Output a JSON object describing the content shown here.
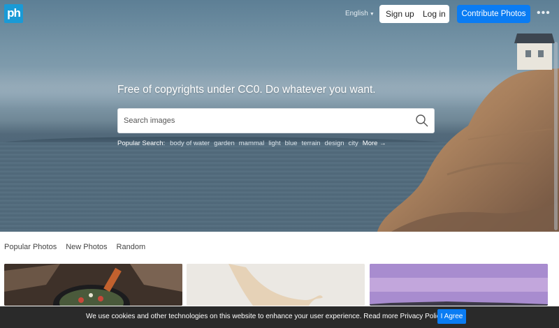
{
  "header": {
    "logo": "ph",
    "language": "English",
    "signup_label": "Sign up",
    "login_label": "Log in",
    "contribute_label": "Contribute Photos",
    "more_label": "•••"
  },
  "hero": {
    "tagline": "Free of copyrights under CC0. Do whatever you want.",
    "search_placeholder": "Search images",
    "popular_label": "Popular Search:",
    "popular_tags": [
      "body of water",
      "garden",
      "mammal",
      "light",
      "blue",
      "terrain",
      "design",
      "city"
    ],
    "more_label": "More →"
  },
  "tabs": [
    "Popular Photos",
    "New Photos",
    "Random"
  ],
  "cookie": {
    "text": "We use cookies and other technologies on this website to enhance your user experience. Read more Privacy Policy.",
    "agree_label": "I Agree"
  },
  "colors": {
    "accent": "#0a7cf3",
    "logo": "#1a9ad6",
    "cookie_bar": "#2a2a2a"
  }
}
